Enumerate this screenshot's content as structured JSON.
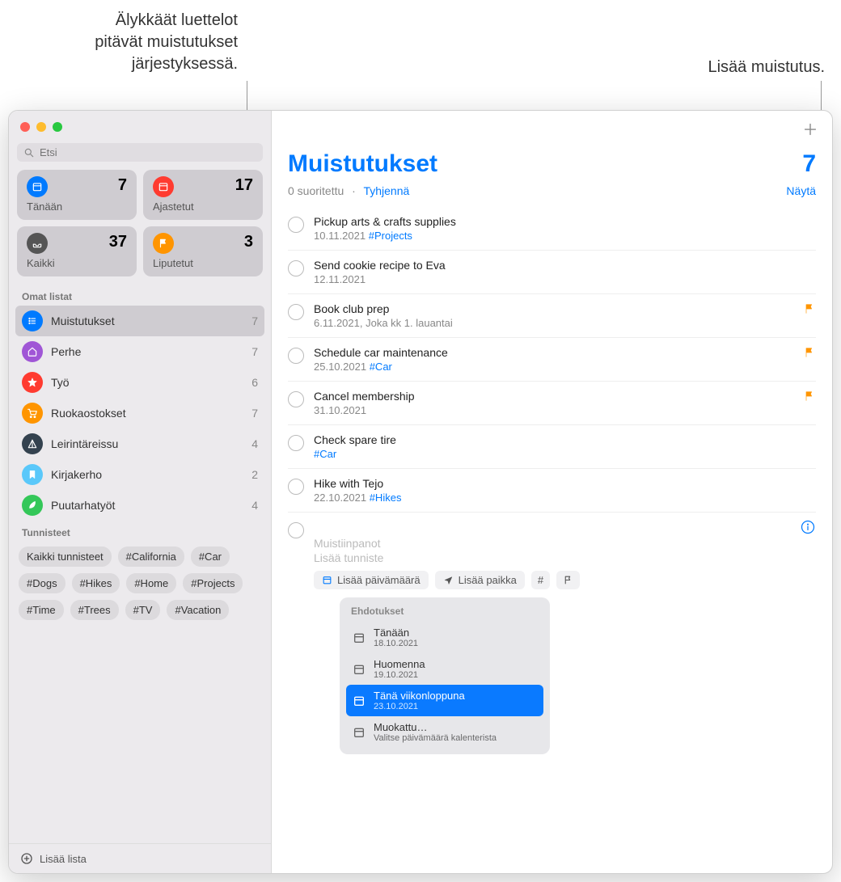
{
  "callouts": {
    "smart": "Älykkäät luettelot\npitävät muistutukset\njärjestyksessä.",
    "add": "Lisää muistutus."
  },
  "search": {
    "placeholder": "Etsi"
  },
  "smart": {
    "today": {
      "label": "Tänään",
      "count": "7"
    },
    "scheduled": {
      "label": "Ajastetut",
      "count": "17"
    },
    "all": {
      "label": "Kaikki",
      "count": "37"
    },
    "flagged": {
      "label": "Liputetut",
      "count": "3"
    }
  },
  "sections": {
    "mylists": "Omat listat",
    "tags": "Tunnisteet"
  },
  "lists": [
    {
      "name": "Muistutukset",
      "count": "7",
      "color": "#007aff",
      "selected": true,
      "icon": "list"
    },
    {
      "name": "Perhe",
      "count": "7",
      "color": "#a056d6",
      "icon": "home"
    },
    {
      "name": "Työ",
      "count": "6",
      "color": "#ff3b30",
      "icon": "star"
    },
    {
      "name": "Ruokaostokset",
      "count": "7",
      "color": "#ff9500",
      "icon": "cart"
    },
    {
      "name": "Leirintäreissu",
      "count": "4",
      "color": "#34424f",
      "icon": "tent"
    },
    {
      "name": "Kirjakerho",
      "count": "2",
      "color": "#5ac8fa",
      "icon": "bookmark"
    },
    {
      "name": "Puutarhatyöt",
      "count": "4",
      "color": "#34c759",
      "icon": "leaf"
    }
  ],
  "tags": [
    "Kaikki tunnisteet",
    "#California",
    "#Car",
    "#Dogs",
    "#Hikes",
    "#Home",
    "#Projects",
    "#Time",
    "#Trees",
    "#TV",
    "#Vacation"
  ],
  "footer": {
    "addlist": "Lisää lista"
  },
  "main": {
    "title": "Muistutukset",
    "count": "7",
    "completed": "0 suoritettu",
    "dot": "·",
    "clear": "Tyhjennä",
    "show": "Näytä"
  },
  "reminders": [
    {
      "title": "Pickup arts & crafts supplies",
      "date": "10.11.2021",
      "tag": "#Projects"
    },
    {
      "title": "Send cookie recipe to Eva",
      "date": "12.11.2021"
    },
    {
      "title": "Book club prep",
      "date": "6.11.2021, Joka kk 1. lauantai",
      "flagged": true
    },
    {
      "title": "Schedule car maintenance",
      "date": "25.10.2021",
      "tag": "#Car",
      "flagged": true
    },
    {
      "title": "Cancel membership",
      "date": "31.10.2021",
      "flagged": true
    },
    {
      "title": "Check spare tire",
      "tag": "#Car"
    },
    {
      "title": "Hike with Tejo",
      "date": "22.10.2021",
      "tag": "#Hikes"
    }
  ],
  "new_reminder": {
    "notes": "Muistiinpanot",
    "addtag": "Lisää tunniste",
    "add_date": "Lisää päivämäärä",
    "add_location": "Lisää paikka"
  },
  "suggestions": {
    "head": "Ehdotukset",
    "items": [
      {
        "title": "Tänään",
        "date": "18.10.2021"
      },
      {
        "title": "Huomenna",
        "date": "19.10.2021"
      },
      {
        "title": "Tänä viikonloppuna",
        "date": "23.10.2021",
        "selected": true
      },
      {
        "title": "Muokattu…",
        "date": "Valitse päivämäärä kalenterista"
      }
    ]
  }
}
